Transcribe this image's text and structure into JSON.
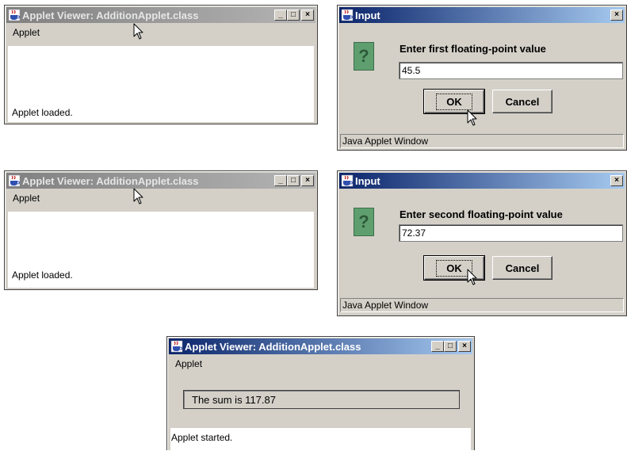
{
  "applet_windows": [
    {
      "title": "Applet Viewer: AdditionApplet.class",
      "menu": "Applet",
      "status": "Applet loaded."
    },
    {
      "title": "Applet Viewer: AdditionApplet.class",
      "menu": "Applet",
      "status": "Applet loaded."
    },
    {
      "title": "Applet Viewer: AdditionApplet.class",
      "menu": "Applet",
      "status": "Applet started.",
      "output": "The sum is 117.87"
    }
  ],
  "input_dialogs": [
    {
      "title": "Input",
      "prompt": "Enter first floating-point value",
      "value": "45.5",
      "ok_label": "OK",
      "cancel_label": "Cancel",
      "window_status": "Java Applet Window",
      "close_glyph": "×"
    },
    {
      "title": "Input",
      "prompt": "Enter second floating-point value",
      "value": "72.37",
      "ok_label": "OK",
      "cancel_label": "Cancel",
      "window_status": "Java Applet Window",
      "close_glyph": "×"
    }
  ],
  "title_buttons": {
    "minimize": "_",
    "maximize": "□",
    "close": "×"
  },
  "question_glyph": "?",
  "colors": {
    "active_title_start": "#0a246a",
    "active_title_end": "#a6caf0",
    "inactive_title": "#808080",
    "window_face": "#d4d0c8",
    "question_icon": "#5f9f6f"
  },
  "icons": [
    "java-cup-icon",
    "minimize-icon",
    "maximize-icon",
    "close-icon",
    "question-icon",
    "mouse-pointer-icon"
  ]
}
